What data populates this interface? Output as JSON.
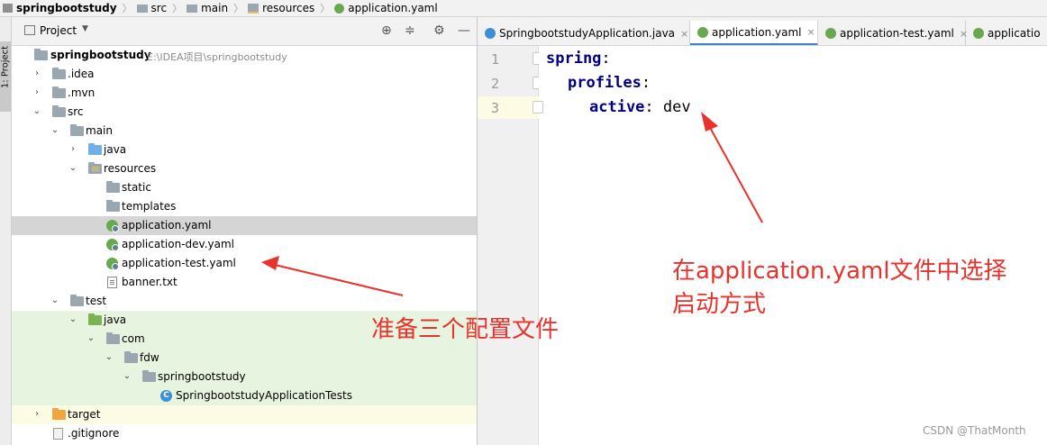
{
  "breadcrumb": {
    "items": [
      "springbootstudy",
      "src",
      "main",
      "resources",
      "application.yaml"
    ]
  },
  "sidebar": {
    "stripe_label": "1: Project"
  },
  "project_panel": {
    "title": "Project",
    "root_name": "springbootstudy",
    "root_path": "E:\\IDEA项目\\springbootstudy",
    "tree": [
      {
        "label": "springbootstudy"
      },
      {
        "label": ".idea"
      },
      {
        "label": ".mvn"
      },
      {
        "label": "src"
      },
      {
        "label": "main"
      },
      {
        "label": "java"
      },
      {
        "label": "resources"
      },
      {
        "label": "static"
      },
      {
        "label": "templates"
      },
      {
        "label": "application.yaml"
      },
      {
        "label": "application-dev.yaml"
      },
      {
        "label": "application-test.yaml"
      },
      {
        "label": "banner.txt"
      },
      {
        "label": "test"
      },
      {
        "label": "java"
      },
      {
        "label": "com"
      },
      {
        "label": "fdw"
      },
      {
        "label": "springbootstudy"
      },
      {
        "label": "SpringbootstudyApplicationTests"
      },
      {
        "label": "target"
      },
      {
        "label": ".gitignore"
      }
    ]
  },
  "editor": {
    "tabs": [
      {
        "label": "SpringbootstudyApplication.java",
        "close": "×"
      },
      {
        "label": "application.yaml",
        "close": "×"
      },
      {
        "label": "application-test.yaml",
        "close": "×"
      },
      {
        "label": "applicatio"
      }
    ],
    "line_numbers": [
      "1",
      "2",
      "3"
    ],
    "lines": [
      {
        "key": "spring",
        "colon": ":",
        "value": ""
      },
      {
        "key": "profiles",
        "colon": ":",
        "value": ""
      },
      {
        "key": "active",
        "colon": ":",
        "value": " dev"
      }
    ]
  },
  "annotations": {
    "right_line1": "在application.yaml文件中选择",
    "right_line2": "启动方式",
    "left": "准备三个配置文件",
    "color": "#e8322b"
  },
  "watermark": "CSDN @ThatMonth",
  "colors": {
    "selection": "#d5d5d5",
    "test_bg": "#e7f4df",
    "target_bg": "#fcfbe3",
    "yaml_key": "#000080",
    "tab_active_underline": "#4083c9"
  }
}
